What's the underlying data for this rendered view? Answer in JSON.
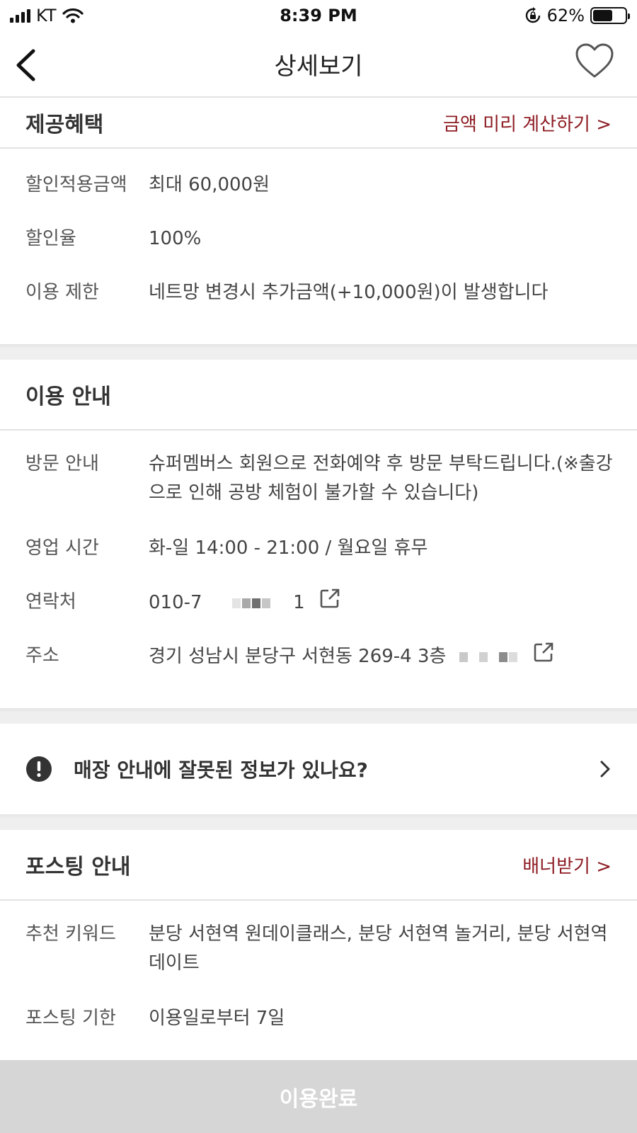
{
  "status_bar": {
    "carrier": "KT",
    "time": "8:39 PM",
    "battery_percent_label": "62%",
    "battery_level": 0.62
  },
  "header": {
    "title": "상세보기",
    "back_icon": "chevron-left-icon",
    "favorite_icon": "heart-icon"
  },
  "benefits": {
    "title": "제공혜택",
    "link": "금액 미리 계산하기 >",
    "rows": [
      {
        "label": "할인적용금액",
        "value": "최대 60,000원"
      },
      {
        "label": "할인율",
        "value": "100%"
      },
      {
        "label": "이용 제한",
        "value": "네트망 변경시 추가금액(+10,000원)이 발생합니다"
      }
    ]
  },
  "usage": {
    "title": "이용 안내",
    "rows": [
      {
        "label": "방문 안내",
        "value": "슈퍼멤버스 회원으로 전화예약 후 방문 부탁드립니다.(※출강으로 인해 공방 체험이 불가할 수 있습니다)"
      },
      {
        "label": "영업 시간",
        "value": "화-일 14:00 - 21:00 / 월요일 휴무"
      },
      {
        "label": "연락처",
        "value_prefix": "010-7",
        "value_suffix": "1"
      },
      {
        "label": "주소",
        "value": "경기 성남시 분당구 서현동 269-4 3층"
      }
    ]
  },
  "report": {
    "text": "매장 안내에 잘못된 정보가 있나요?",
    "icon": "exclamation-circle-icon",
    "chevron": "chevron-right-icon"
  },
  "posting": {
    "title": "포스팅 안내",
    "link": "배너받기 >",
    "rows": [
      {
        "label": "추천 키워드",
        "value": "분당 서현역 원데이클래스, 분당 서현역 놀거리, 분당 서현역 데이트"
      },
      {
        "label": "포스팅 기한",
        "value": "이용일로부터 7일"
      }
    ]
  },
  "footer": {
    "button_label": "이용완료"
  },
  "colors": {
    "accent": "#8e1d24",
    "divider": "#e2e2e2",
    "gap": "#efefef",
    "button_disabled": "#d6d6d6"
  }
}
